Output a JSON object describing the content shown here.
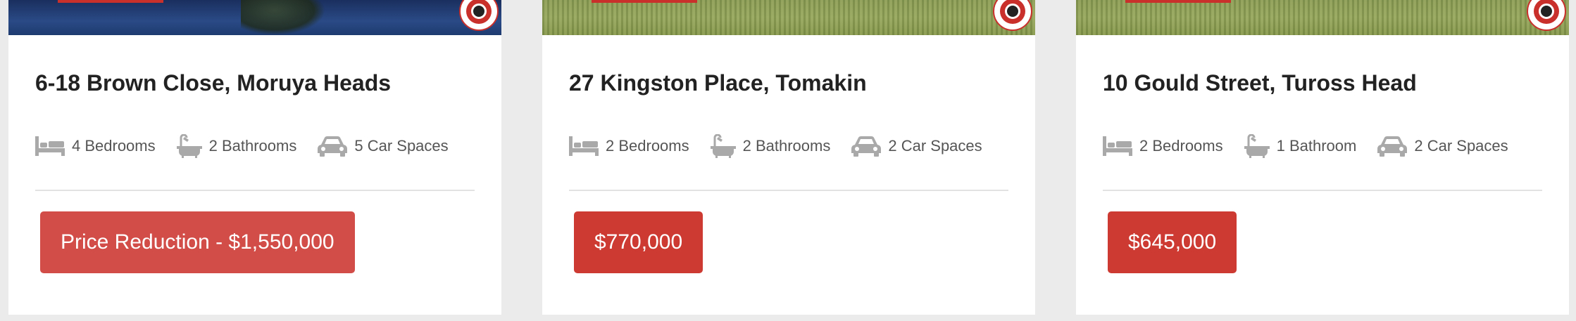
{
  "listings": [
    {
      "address": "6-18 Brown Close, Moruya Heads",
      "bedrooms": "4 Bedrooms",
      "bathrooms": "2 Bathrooms",
      "car_spaces": "5 Car Spaces",
      "price": "Price Reduction - $1,550,000"
    },
    {
      "address": "27 Kingston Place, Tomakin",
      "bedrooms": "2 Bedrooms",
      "bathrooms": "2 Bathrooms",
      "car_spaces": "2 Car Spaces",
      "price": "$770,000"
    },
    {
      "address": "10 Gould Street, Tuross Head",
      "bedrooms": "2 Bedrooms",
      "bathrooms": "1 Bathroom",
      "car_spaces": "2 Car Spaces",
      "price": "$645,000"
    }
  ],
  "icons": {
    "bed": "bed-icon",
    "bath": "bath-icon",
    "car": "car-icon"
  },
  "colors": {
    "price_button": "#cc3a32",
    "price_button_reduced": "#d24d48",
    "page_background": "#ebebeb"
  }
}
